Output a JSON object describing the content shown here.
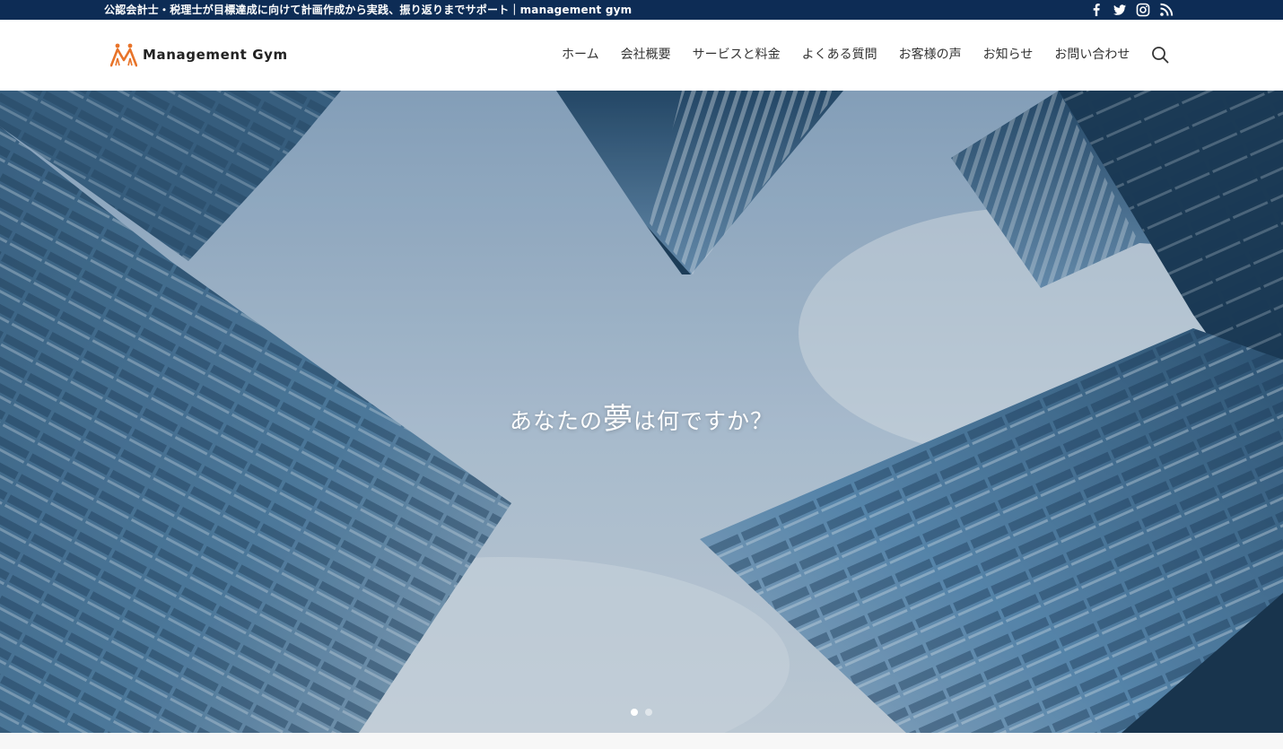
{
  "topbar": {
    "tagline": "公認会計士・税理士が目標達成に向けて計画作成から実践、振り返りまでサポート｜management gym",
    "social_icons": [
      "facebook-icon",
      "twitter-icon",
      "instagram-icon",
      "rss-icon"
    ]
  },
  "header": {
    "logo_text": "Management Gym",
    "nav": [
      {
        "label": "ホーム"
      },
      {
        "label": "会社概要"
      },
      {
        "label": "サービスと料金"
      },
      {
        "label": "よくある質問"
      },
      {
        "label": "お客様の声"
      },
      {
        "label": "お知らせ"
      },
      {
        "label": "お問い合わせ"
      }
    ],
    "search_icon": "search-icon"
  },
  "hero": {
    "headline_pre": "あなたの",
    "headline_em": "夢",
    "headline_post": "は何ですか？",
    "slide_count": 2,
    "active_slide": 1
  },
  "colors": {
    "topbar_bg": "#0d2c55",
    "logo_orange": "#e8742a",
    "sky": "#a9bfd6"
  }
}
